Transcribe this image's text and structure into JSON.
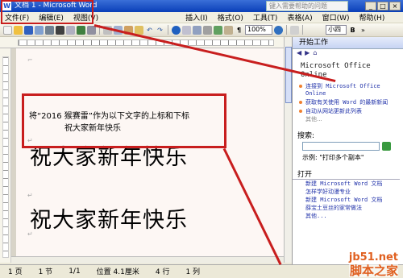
{
  "window": {
    "title": "文档 1 - Microsoft Word",
    "help_search_placeholder": "键入需要帮助的问题"
  },
  "menu": [
    "文件(F)",
    "编辑(E)",
    "视图(V)",
    "插入(I)",
    "格式(O)",
    "工具(T)",
    "表格(A)",
    "窗口(W)",
    "帮助(H)"
  ],
  "toolbar": {
    "zoom": "100%",
    "font_size": "小四"
  },
  "document": {
    "instruction": "将“2016 猴赛雷”作为以下文字的上标和下标",
    "line2": "祝大家新年快乐",
    "big_line_1": "祝大家新年快乐",
    "big_line_2": "祝大家新年快乐"
  },
  "task_pane": {
    "header": "开始工作",
    "product_title": "Microsoft Office Online",
    "links": [
      "连接到 Microsoft Office Online",
      "获取有关使用 Word 的最新新闻",
      "自动从网站更新此列表"
    ],
    "more": "其他...",
    "search_label": "搜索:",
    "example": "示例: \"打印多个副本\"",
    "open_header": "打开",
    "open_items": [
      "新建 Microsoft Word 文档",
      "怎样学好动漫专业",
      "新建 Microsoft Word 文档",
      "薛宝土豆丝的家常做法"
    ],
    "open_more": "其他..."
  },
  "status": {
    "page": "1 页",
    "section": "1 节",
    "pages": "1/1",
    "position": "位置 4.1厘米",
    "line": "4 行",
    "col": "1 列"
  },
  "watermark": {
    "site": "jb51.net",
    "brand": "脚本之家"
  },
  "colors": {
    "highlight": "#c81e1e",
    "titlebar": "#0a3fb8"
  }
}
